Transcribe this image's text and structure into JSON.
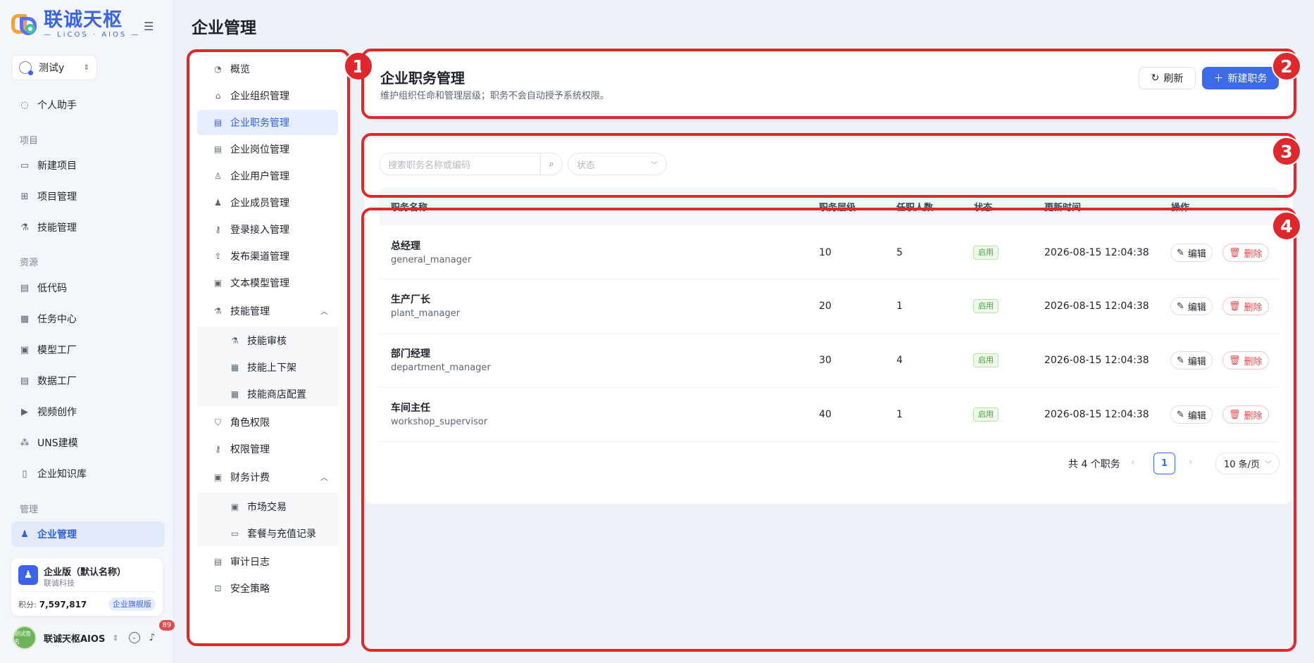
{
  "app": {
    "logo_text": "联诚天枢",
    "logo_sub": "— LiCOS · AIOS —"
  },
  "nav": {
    "user_chip": "测试y",
    "assistant": "个人助手",
    "group_project": "项目",
    "new_project": "新建项目",
    "project_mgmt": "项目管理",
    "skill_mgmt": "技能管理",
    "group_resource": "资源",
    "lowcode": "低代码",
    "task_center": "任务中心",
    "model_factory": "模型工厂",
    "data_factory": "数据工厂",
    "video_creation": "视频创作",
    "uns_modeling": "UNS建模",
    "knowledge_base": "企业知识库",
    "group_manage": "管理",
    "enterprise_mgmt": "企业管理"
  },
  "plan": {
    "name": "企业版（默认名称）",
    "org": "联诚科技",
    "points_label": "积分:",
    "points": "7,597,817",
    "badge": "企业旗舰版"
  },
  "me": {
    "avatar_text": "测试签名",
    "name": "联诚天枢AIOS",
    "notifications": "89"
  },
  "page": {
    "title": "企业管理"
  },
  "submenu": {
    "overview": "概览",
    "org": "企业组织管理",
    "duty": "企业职务管理",
    "post": "企业岗位管理",
    "user": "企业用户管理",
    "member": "企业成员管理",
    "login": "登录接入管理",
    "channel": "发布渠道管理",
    "text_model": "文本模型管理",
    "skill": "技能管理",
    "skill_review": "技能审核",
    "skill_shelf": "技能上下架",
    "skill_store": "技能商店配置",
    "role": "角色权限",
    "perm": "权限管理",
    "finance": "财务计费",
    "market": "市场交易",
    "package": "套餐与充值记录",
    "audit": "审计日志",
    "security": "安全策略"
  },
  "header": {
    "title": "企业职务管理",
    "subtitle": "维护组织任命和管理层级；职务不会自动授予系统权限。",
    "refresh": "刷新",
    "new": "新建职务"
  },
  "filters": {
    "search_placeholder": "搜索职务名称或编码",
    "status_placeholder": "状态"
  },
  "table": {
    "columns": [
      "职务名称",
      "职务层级",
      "任职人数",
      "状态",
      "更新时间",
      "操作"
    ],
    "rows": [
      {
        "name": "总经理",
        "code": "general_manager",
        "level": "10",
        "count": "5",
        "status": "启用",
        "updated": "2026-08-15 12:04:38"
      },
      {
        "name": "生产厂长",
        "code": "plant_manager",
        "level": "20",
        "count": "1",
        "status": "启用",
        "updated": "2026-08-15 12:04:38"
      },
      {
        "name": "部门经理",
        "code": "department_manager",
        "level": "30",
        "count": "4",
        "status": "启用",
        "updated": "2026-08-15 12:04:38"
      },
      {
        "name": "车间主任",
        "code": "workshop_supervisor",
        "level": "40",
        "count": "1",
        "status": "启用",
        "updated": "2026-08-15 12:04:38"
      }
    ],
    "edit": "编辑",
    "delete": "删除"
  },
  "pagination": {
    "total": "共 4 个职务",
    "current": "1",
    "page_size": "10 条/页"
  },
  "annotations": [
    "1",
    "2",
    "3",
    "4"
  ],
  "colors": {
    "primary": "#3b6be8",
    "annotation": "#e0282c",
    "status_ok": "#3fa23a",
    "danger": "#e04c4c"
  }
}
